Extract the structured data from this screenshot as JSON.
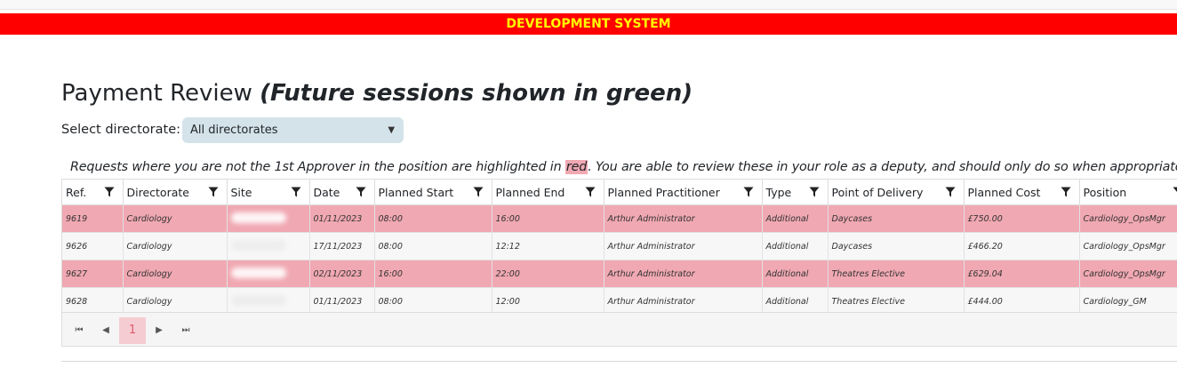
{
  "banner": "DEVELOPMENT SYSTEM",
  "page": {
    "title": "Payment Review",
    "subtitle": "(Future sessions shown in green)"
  },
  "directorate": {
    "label": "Select directorate:",
    "selected": "All directorates"
  },
  "notice": {
    "before": "Requests where you are not the 1st Approver in the position are highlighted in",
    "red_word": "red",
    "after": ". You are able to review these in your role as a deputy, and should only do so when appropriate."
  },
  "columns": [
    "Ref.",
    "Directorate",
    "Site",
    "Date",
    "Planned Start",
    "Planned End",
    "Planned Practitioner",
    "Type",
    "Point of Delivery",
    "Planned Cost",
    "Position"
  ],
  "rows": [
    {
      "ref": "9619",
      "directorate": "Cardiology",
      "date": "01/11/2023",
      "start": "08:00",
      "end": "16:00",
      "practitioner": "Arthur Administrator",
      "type": "Additional",
      "pod": "Daycases",
      "cost": "£750.00",
      "position": "Cardiology_OpsMgr",
      "highlighted": true
    },
    {
      "ref": "9626",
      "directorate": "Cardiology",
      "date": "17/11/2023",
      "start": "08:00",
      "end": "12:12",
      "practitioner": "Arthur Administrator",
      "type": "Additional",
      "pod": "Daycases",
      "cost": "£466.20",
      "position": "Cardiology_OpsMgr",
      "highlighted": false
    },
    {
      "ref": "9627",
      "directorate": "Cardiology",
      "date": "02/11/2023",
      "start": "16:00",
      "end": "22:00",
      "practitioner": "Arthur Administrator",
      "type": "Additional",
      "pod": "Theatres Elective",
      "cost": "£629.04",
      "position": "Cardiology_OpsMgr",
      "highlighted": true
    },
    {
      "ref": "9628",
      "directorate": "Cardiology",
      "date": "01/11/2023",
      "start": "08:00",
      "end": "12:00",
      "practitioner": "Arthur Administrator",
      "type": "Additional",
      "pod": "Theatres Elective",
      "cost": "£444.00",
      "position": "Cardiology_GM",
      "highlighted": false
    }
  ],
  "pager": {
    "current_page": "1"
  },
  "colors": {
    "banner_bg": "#ff0000",
    "banner_text": "#ffff00",
    "highlight_row": "#f0a8b2",
    "select_bg": "#d4e3ea"
  },
  "icons": {
    "filter": "filter-icon",
    "first": "first-page-icon",
    "prev": "prev-page-icon",
    "next": "next-page-icon",
    "last": "last-page-icon",
    "dropdown": "chevron-down-icon"
  }
}
